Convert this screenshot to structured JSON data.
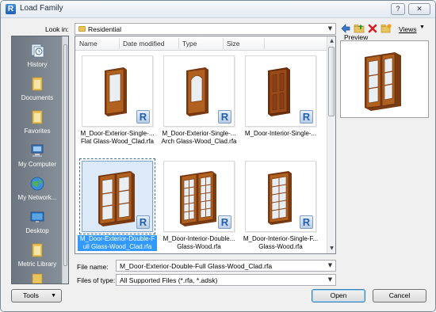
{
  "window": {
    "title": "Load Family"
  },
  "titlebar": {
    "help_glyph": "?",
    "close_glyph": "✕"
  },
  "lookin": {
    "label": "Look in:",
    "value": "Residential"
  },
  "toolbar": {
    "views_label": "Views",
    "preview_label": "Preview"
  },
  "places": [
    {
      "label": "History",
      "icon": "history-icon"
    },
    {
      "label": "Documents",
      "icon": "folder-icon"
    },
    {
      "label": "Favorites",
      "icon": "folder-icon"
    },
    {
      "label": "My Computer",
      "icon": "computer-icon"
    },
    {
      "label": "My Network...",
      "icon": "network-icon"
    },
    {
      "label": "Desktop",
      "icon": "desktop-icon"
    },
    {
      "label": "Metric Library",
      "icon": "folder-icon"
    }
  ],
  "columns": [
    "Name",
    "Date modified",
    "Type",
    "Size"
  ],
  "files": [
    {
      "name": "M_Door-Exterior-Single-...\nFlat Glass-Wood_Clad.rfa",
      "selected": false
    },
    {
      "name": "M_Door-Exterior-Single-...\nArch Glass-Wood_Clad.rfa",
      "selected": false
    },
    {
      "name": "M_Door-Interior-Single-...",
      "selected": false
    },
    {
      "name": "M_Door-Exterior-Double-F\null Glass-Wood_Clad.rfa",
      "selected": true
    },
    {
      "name": "M_Door-Interior-Double...\nGlass-Wood.rfa",
      "selected": false
    },
    {
      "name": "M_Door-Interior-Single-F...\nGlass-Wood.rfa",
      "selected": false
    }
  ],
  "badge_letter": "R",
  "filename": {
    "label": "File name:",
    "value": "M_Door-Exterior-Double-Full Glass-Wood_Clad.rfa"
  },
  "filetype": {
    "label": "Files of type:",
    "value": "All Supported Files  (*.rfa, *.adsk)"
  },
  "buttons": {
    "tools": "Tools",
    "open": "Open",
    "cancel": "Cancel"
  },
  "colors": {
    "selection": "#3399ff",
    "door_wood": "#a8541e",
    "folder": "#e8c45c"
  }
}
